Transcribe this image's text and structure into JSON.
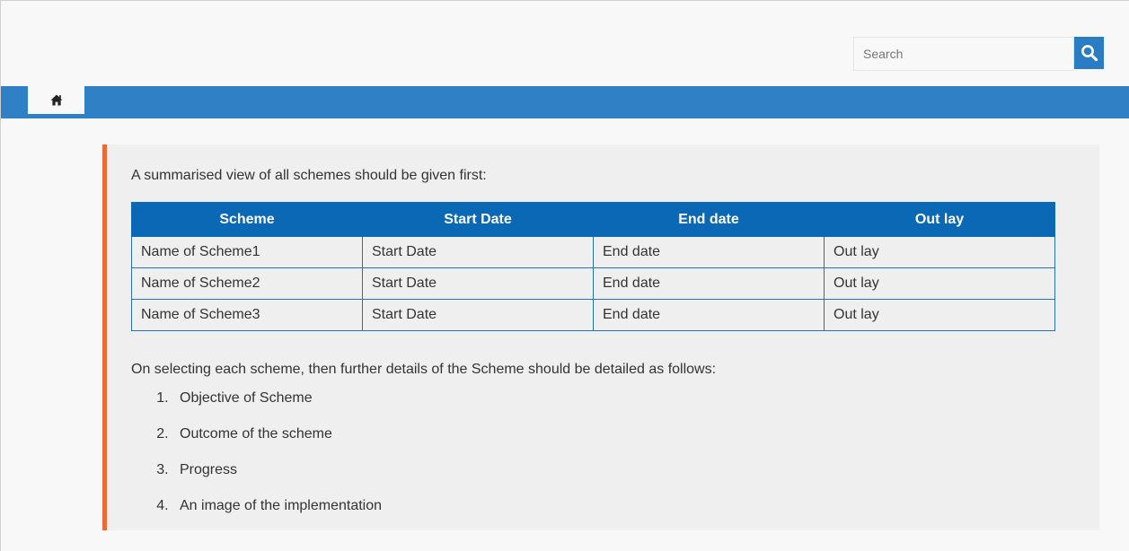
{
  "search": {
    "placeholder": "Search"
  },
  "nav": {
    "home_icon": "home-icon"
  },
  "content": {
    "intro_text": "A summarised view of all schemes should be given first:",
    "table": {
      "headers": [
        "Scheme",
        "Start Date",
        "End date",
        "Out lay"
      ],
      "rows": [
        [
          "Name of Scheme1",
          "Start Date",
          "End date",
          "Out lay"
        ],
        [
          "Name of Scheme2",
          "Start Date",
          "End date",
          "Out lay"
        ],
        [
          "Name of Scheme3",
          "Start Date",
          "End date",
          "Out lay"
        ]
      ]
    },
    "followup_text": "On selecting each scheme, then further details of the Scheme should be detailed as follows:",
    "details": [
      "Objective of Scheme",
      "Outcome of the scheme",
      "Progress",
      "An image of the implementation"
    ]
  },
  "colors": {
    "nav_blue": "#2f80c5",
    "table_header_blue": "#0a68b5",
    "accent_orange": "#ec6a35",
    "content_bg": "#efefef"
  }
}
